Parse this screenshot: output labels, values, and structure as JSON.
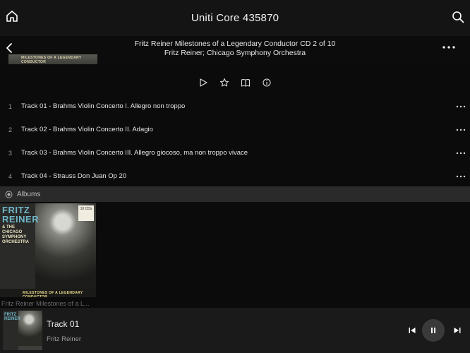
{
  "topbar": {
    "title": "Uniti Core 435870"
  },
  "album": {
    "title": "Fritz Reiner Milestones of a Legendary Conductor CD 2 of 10",
    "artists": "Fritz Reiner; Chicago Symphony Orchestra",
    "cover_strip_text": "MILESTONES OF A LEGENDARY CONDUCTOR"
  },
  "tracks": [
    {
      "num": "1",
      "name": "Track 01 - Brahms Violin Concerto I. Allegro non troppo"
    },
    {
      "num": "2",
      "name": "Track 02 - Brahms Violin Concerto II. Adagio"
    },
    {
      "num": "3",
      "name": "Track 03 - Brahms Violin Concerto III. Allegro giocoso, ma non troppo vivace"
    },
    {
      "num": "4",
      "name": "Track 04 - Strauss Don Juan Op 20"
    }
  ],
  "albums_section": {
    "label": "Albums",
    "items": [
      {
        "caption": "Fritz Reiner Milestones of a L...",
        "cover_big": "FRITZ REINER",
        "cover_small": "& THE CHICAGO SYMPHONY ORCHESTRA",
        "cover_badge": "10 CDs",
        "cover_strip": "MILESTONES OF A LEGENDARY CONDUCTOR"
      }
    ]
  },
  "now_playing": {
    "title": "Track 01",
    "artist": "Fritz Reiner",
    "thumb_text": "FRITZ REINER"
  },
  "colors": {
    "background": "#0b0b0b",
    "topbar": "#141414",
    "section": "#2a2a2a",
    "player": "#1a1a1a",
    "cover_accent": "#6fb6c8"
  }
}
